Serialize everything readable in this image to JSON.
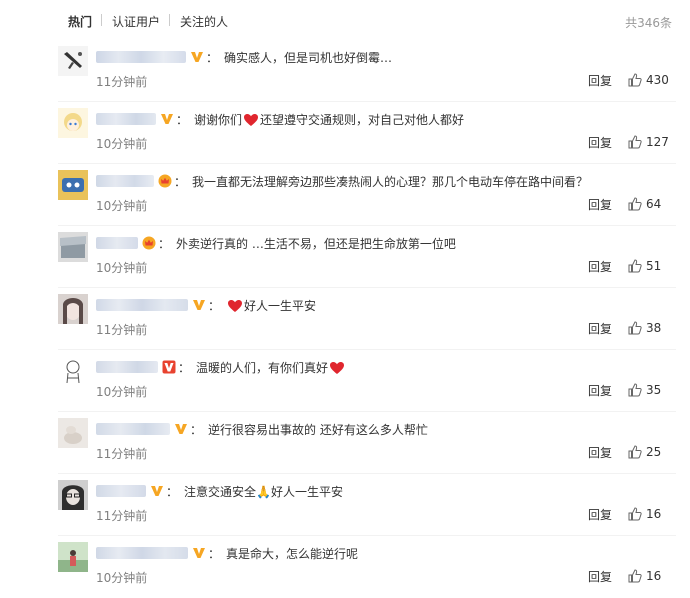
{
  "tabs": [
    "热门",
    "认证用户",
    "关注的人"
  ],
  "total": "共346条",
  "reply_label": "回复",
  "colors": {
    "accent": "#eb7350",
    "heart": "#e0262e",
    "vip_orange": "#f6a623",
    "vip_red": "#e8422f"
  },
  "comments": [
    {
      "name": "—————忘带枪",
      "badge": "v",
      "text": "确实感人，但是司机也好倒霉…",
      "time": "11分钟前",
      "likes": "430"
    },
    {
      "name": "——————",
      "badge": "v",
      "text_pre": "谢谢你们",
      "text_post": "还望遵守交通规则，对自己对他人都好",
      "time": "10分钟前",
      "likes": "127",
      "heart": true
    },
    {
      "name": "————_",
      "badge": "crown",
      "text": "我一直都无法理解旁边那些凑热闹人的心理？那几个电动车停在路中间看？",
      "time": "10分钟前",
      "likes": "64"
    },
    {
      "name": "——————-",
      "badge": "crown",
      "text": "外卖逆行真的 …生活不易，但还是把生命放第一位吧",
      "time": "10分钟前",
      "likes": "51"
    },
    {
      "name": "——————",
      "badge": "v",
      "text_pre": "",
      "text_post": "好人一生平安",
      "time": "11分钟前",
      "likes": "38",
      "heart": true
    },
    {
      "name": "——————",
      "badge": "vred",
      "text_pre": "温暖的人们，有你们真好",
      "text_post": "",
      "time": "10分钟前",
      "likes": "35",
      "heart": true
    },
    {
      "name": "——————",
      "badge": "v",
      "text": "逆行很容易出事故的 还好有这么多人帮忙",
      "time": "11分钟前",
      "likes": "25"
    },
    {
      "name": "—————",
      "badge": "v",
      "text": "注意交通安全🙏好人一生平安",
      "time": "11分钟前",
      "likes": "16"
    },
    {
      "name": "风———————",
      "badge": "v",
      "text": "真是命大，怎么能逆行呢",
      "time": "10分钟前",
      "likes": "16"
    }
  ]
}
